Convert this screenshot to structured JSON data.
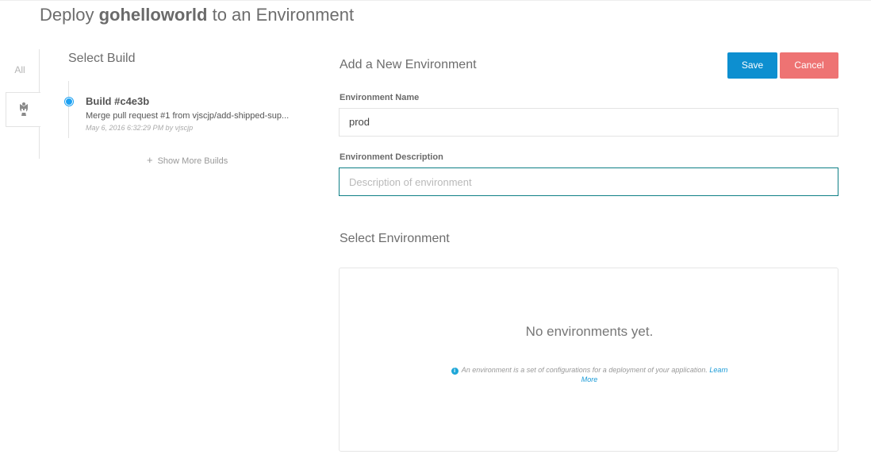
{
  "page": {
    "title_prefix": "Deploy ",
    "app_name": "gohelloworld",
    "title_suffix": " to an Environment"
  },
  "filters": {
    "all_label": "All",
    "active_icon": "jenkins-butler-icon"
  },
  "builds": {
    "section_title": "Select Build",
    "items": [
      {
        "title": "Build #c4e3b",
        "message": "Merge pull request #1 from vjscjp/add-shipped-sup...",
        "meta": "May 6, 2016 6:32:29 PM by vjscjp",
        "selected": true
      }
    ],
    "show_more_label": "Show More Builds"
  },
  "form": {
    "section_title": "Add a New Environment",
    "save_label": "Save",
    "cancel_label": "Cancel",
    "name_label": "Environment Name",
    "name_value": "prod",
    "description_label": "Environment Description",
    "description_placeholder": "Description of environment",
    "description_value": ""
  },
  "environments": {
    "section_title": "Select Environment",
    "empty_text": "No environments yet.",
    "help_text": "An environment is a set of configurations for a deployment of your application.",
    "learn_more_label": "Learn More"
  },
  "colors": {
    "save": "#0d8fd0",
    "cancel": "#ee7373",
    "selected_dot": "#1da1f2",
    "focus_border": "#0e7f86",
    "link": "#1a9bd7"
  }
}
